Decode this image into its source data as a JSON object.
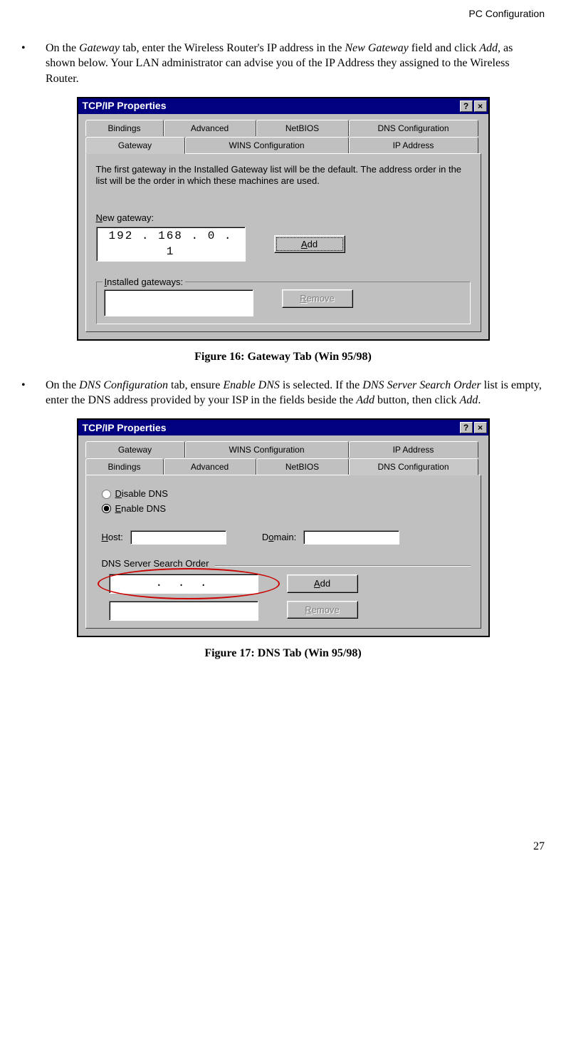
{
  "header": {
    "section": "PC Configuration"
  },
  "bullets": {
    "b1_pre": "On the ",
    "b1_i1": "Gateway",
    "b1_mid1": " tab, enter the Wireless Router's IP address in the ",
    "b1_i2": "New Gateway",
    "b1_mid2": " field and click ",
    "b1_i3": "Add",
    "b1_post": ", as shown below. Your LAN administrator can advise you of the IP Address they assigned to the Wireless Router.",
    "b2_pre": "On the ",
    "b2_i1": "DNS Configuration",
    "b2_mid1": " tab, ensure ",
    "b2_i2": "Enable DNS",
    "b2_mid2": " is selected. If the ",
    "b2_i3": "DNS Server Search Order",
    "b2_mid3": " list is empty, enter the DNS address provided by your ISP in the fields beside the ",
    "b2_i4": "Add",
    "b2_mid4": " button, then click ",
    "b2_i5": "Add",
    "b2_post": "."
  },
  "dialog1": {
    "title": "TCP/IP Properties",
    "help_btn": "?",
    "close_btn": "×",
    "tabs_row1": {
      "t1": "Bindings",
      "t2": "Advanced",
      "t3": "NetBIOS",
      "t4": "DNS Configuration"
    },
    "tabs_row2": {
      "t1": "Gateway",
      "t2": "WINS Configuration",
      "t3": "IP Address"
    },
    "info": "The first gateway in the Installed Gateway list will be the default. The address order in the list will be the order in which these machines are used.",
    "new_gateway_u": "N",
    "new_gateway_rest": "ew gateway:",
    "ip": "192 . 168 .   0  .   1",
    "add_u": "A",
    "add_rest": "dd",
    "installed_u": "I",
    "installed_rest": "nstalled gateways:",
    "remove_u": "R",
    "remove_rest": "emove"
  },
  "figcap1": "Figure 16: Gateway Tab (Win 95/98)",
  "dialog2": {
    "title": "TCP/IP Properties",
    "help_btn": "?",
    "close_btn": "×",
    "tabs_row1": {
      "t1": "Gateway",
      "t2": "WINS Configuration",
      "t3": "IP Address"
    },
    "tabs_row2": {
      "t1": "Bindings",
      "t2": "Advanced",
      "t3": "NetBIOS",
      "t4": "DNS Configuration"
    },
    "disable_u": "D",
    "disable_rest": "isable DNS",
    "enable_u": "E",
    "enable_rest": "nable DNS",
    "host_u": "H",
    "host_rest": "ost:",
    "domain_u": "D",
    "domain_rest": "omain:",
    "search_order": "DNS Server Search Order",
    "ip_empty": ".        .        .",
    "add_u": "A",
    "add_rest": "dd",
    "remove_u": "R",
    "remove_rest": "emove"
  },
  "figcap2": "Figure 17: DNS Tab (Win 95/98)",
  "page_num": "27"
}
